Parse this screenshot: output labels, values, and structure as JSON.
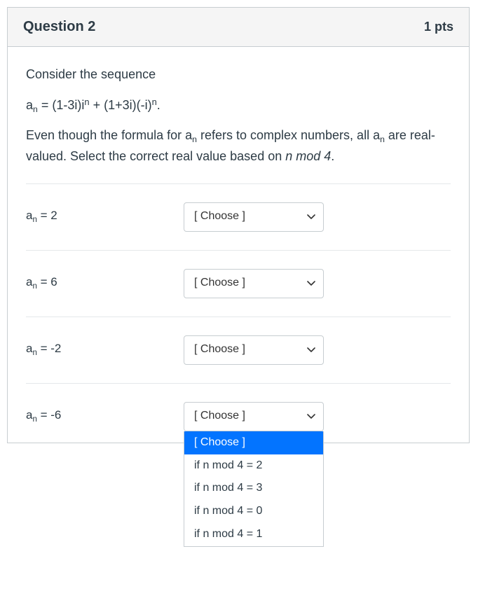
{
  "header": {
    "title": "Question 2",
    "points": "1 pts"
  },
  "prompt": {
    "line1": "Consider the sequence",
    "formula_prefix": "a",
    "formula_eq": " = (1-3i)i",
    "formula_mid": " + (1+3i)(-i)",
    "formula_end": ".",
    "line3a": "Even though the formula for a",
    "line3b": " refers to complex numbers, all a",
    "line3c": " are real-valued. Select the correct real value based on ",
    "line3_italic": "n mod 4",
    "line3_period": "."
  },
  "rows": [
    {
      "label_prefix": "a",
      "label_value": " = 2",
      "selected": "[ Choose ]"
    },
    {
      "label_prefix": "a",
      "label_value": " = 6",
      "selected": "[ Choose ]"
    },
    {
      "label_prefix": "a",
      "label_value": " = -2",
      "selected": "[ Choose ]"
    },
    {
      "label_prefix": "a",
      "label_value": " = -6",
      "selected": "[ Choose ]"
    }
  ],
  "dropdown": {
    "options": [
      "[ Choose ]",
      "if n mod 4 = 2",
      "if n mod 4 = 3",
      "if n mod 4 = 0",
      "if n mod 4 = 1"
    ],
    "highlight_index": 0
  },
  "sub_n": "n"
}
